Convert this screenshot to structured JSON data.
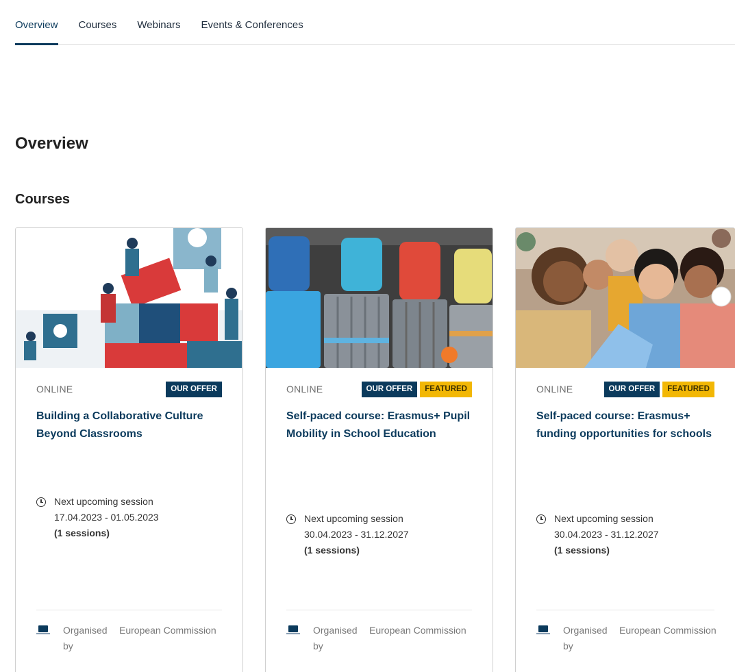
{
  "tabs": [
    {
      "label": "Overview",
      "active": true
    },
    {
      "label": "Courses",
      "active": false
    },
    {
      "label": "Webinars",
      "active": false
    },
    {
      "label": "Events & Conferences",
      "active": false
    }
  ],
  "page_title": "Overview",
  "section_title": "Courses",
  "colors": {
    "accent": "#0b3a5c",
    "featured": "#f2b705"
  },
  "cards": [
    {
      "format": "ONLINE",
      "badges": {
        "offer": "OUR OFFER"
      },
      "title": "Building a Collaborative Culture Beyond Classrooms",
      "session_label": "Next upcoming session",
      "session_dates": "17.04.2023 - 01.05.2023",
      "session_count": "(1 sessions)",
      "organised_label": "Organised by",
      "organiser": "European Commission"
    },
    {
      "format": "ONLINE",
      "badges": {
        "offer": "OUR OFFER",
        "featured": "FEATURED"
      },
      "title": "Self-paced course: Erasmus+ Pupil Mobility in School Education",
      "session_label": "Next upcoming session",
      "session_dates": "30.04.2023 - 31.12.2027",
      "session_count": "(1 sessions)",
      "organised_label": "Organised by",
      "organiser": "European Commission"
    },
    {
      "format": "ONLINE",
      "badges": {
        "offer": "OUR OFFER",
        "featured": "FEATURED"
      },
      "title": "Self-paced course: Erasmus+ funding opportunities for schools",
      "session_label": "Next upcoming session",
      "session_dates": "30.04.2023 - 31.12.2027",
      "session_count": "(1 sessions)",
      "organised_label": "Organised by",
      "organiser": "European Commission"
    }
  ]
}
